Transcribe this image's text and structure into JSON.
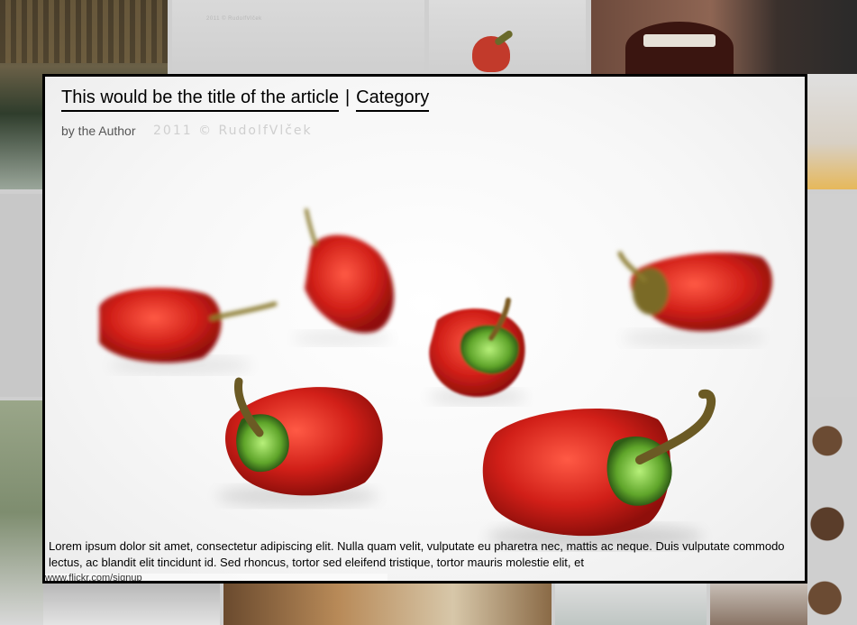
{
  "gallery": {
    "tiles": [
      "hut-photo",
      "blank-page-photo",
      "pepper-photo",
      "mouth-photo",
      "side-photo-1",
      "side-photo-2",
      "right-photo-1",
      "right-photo-2",
      "cupcakes-photo",
      "bottom-photo-1",
      "pizza-photo",
      "bottom-photo-3",
      "bottom-photo-4"
    ]
  },
  "article": {
    "title": "This would be the title of the article",
    "separator": "|",
    "category": "Category",
    "author": "by the Author",
    "watermark": "2011 © RudolfVlček",
    "excerpt": "Lorem ipsum dolor sit amet, consectetur adipiscing elit. Nulla quam velit, vulputate eu pharetra nec, mattis ac neque. Duis vulputate commodo lectus, ac blandit elit tincidunt id. Sed rhoncus, tortor sed eleifend tristique, tortor mauris molestie elit, et",
    "url_fragment": "www.flickr.com/signup"
  },
  "colors": {
    "pepper_red": "#c8201a",
    "pepper_green": "#5fa52a",
    "stem_brown": "#6b5a24",
    "border": "#000000"
  }
}
